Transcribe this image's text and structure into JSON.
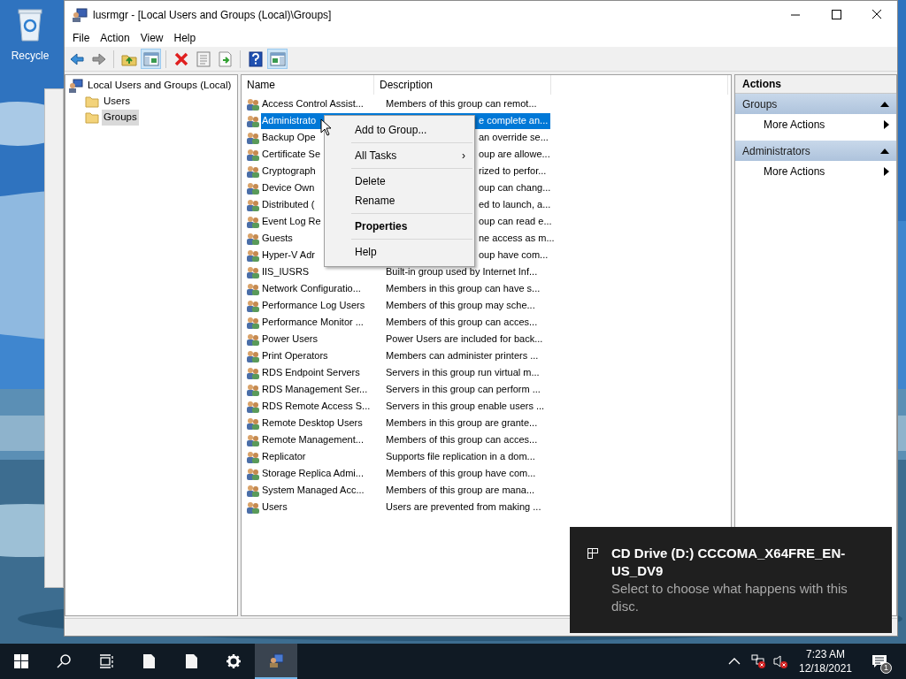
{
  "desktop": {
    "icons": [
      {
        "label": "Recycle"
      }
    ]
  },
  "window": {
    "title": "lusrmgr - [Local Users and Groups (Local)\\Groups]"
  },
  "menu": [
    "File",
    "Action",
    "View",
    "Help"
  ],
  "toolbar": [
    {
      "kind": "back",
      "pressed": false
    },
    {
      "kind": "forward",
      "pressed": false
    },
    {
      "kind": "sep"
    },
    {
      "kind": "up",
      "pressed": false
    },
    {
      "kind": "tree",
      "pressed": true
    },
    {
      "kind": "sep"
    },
    {
      "kind": "delete",
      "pressed": false
    },
    {
      "kind": "properties",
      "pressed": false
    },
    {
      "kind": "export",
      "pressed": false
    },
    {
      "kind": "sep"
    },
    {
      "kind": "help",
      "pressed": false
    },
    {
      "kind": "actionpane",
      "pressed": true
    }
  ],
  "tree": [
    {
      "label": "Local Users and Groups (Local)",
      "kind": "computer",
      "selected": false,
      "children": [
        {
          "label": "Users",
          "kind": "folder",
          "selected": false
        },
        {
          "label": "Groups",
          "kind": "folder",
          "selected": true
        }
      ]
    }
  ],
  "table": {
    "columns": [
      "Name",
      "Description"
    ],
    "rows": [
      {
        "name": "Access Control Assist...",
        "description": "Members of this group can remot...",
        "selected": false
      },
      {
        "name": "Administrato",
        "description": "e complete an...",
        "selected": true
      },
      {
        "name": "Backup Ope",
        "description": "an override se...",
        "selected": false
      },
      {
        "name": "Certificate Se",
        "description": "oup are allowe...",
        "selected": false
      },
      {
        "name": "Cryptograph",
        "description": "rized to perfor...",
        "selected": false
      },
      {
        "name": "Device Own",
        "description": "oup can chang...",
        "selected": false
      },
      {
        "name": "Distributed (",
        "description": "ed to launch, a...",
        "selected": false
      },
      {
        "name": "Event Log Re",
        "description": "oup can read e...",
        "selected": false
      },
      {
        "name": "Guests",
        "description": "ne access as m...",
        "selected": false
      },
      {
        "name": "Hyper-V Adr",
        "description": "oup have com...",
        "selected": false
      },
      {
        "name": "IIS_IUSRS",
        "description": "Built-in group used by Internet Inf...",
        "selected": false
      },
      {
        "name": "Network Configuratio...",
        "description": "Members in this group can have s...",
        "selected": false
      },
      {
        "name": "Performance Log Users",
        "description": "Members of this group may sche...",
        "selected": false
      },
      {
        "name": "Performance Monitor ...",
        "description": "Members of this group can acces...",
        "selected": false
      },
      {
        "name": "Power Users",
        "description": "Power Users are included for back...",
        "selected": false
      },
      {
        "name": "Print Operators",
        "description": "Members can administer printers ...",
        "selected": false
      },
      {
        "name": "RDS Endpoint Servers",
        "description": "Servers in this group run virtual m...",
        "selected": false
      },
      {
        "name": "RDS Management Ser...",
        "description": "Servers in this group can perform ...",
        "selected": false
      },
      {
        "name": "RDS Remote Access S...",
        "description": "Servers in this group enable users ...",
        "selected": false
      },
      {
        "name": "Remote Desktop Users",
        "description": "Members in this group are grante...",
        "selected": false
      },
      {
        "name": "Remote Management...",
        "description": "Members of this group can acces...",
        "selected": false
      },
      {
        "name": "Replicator",
        "description": "Supports file replication in a dom...",
        "selected": false
      },
      {
        "name": "Storage Replica Admi...",
        "description": "Members of this group have com...",
        "selected": false
      },
      {
        "name": "System Managed Acc...",
        "description": "Members of this group are mana...",
        "selected": false
      },
      {
        "name": "Users",
        "description": "Users are prevented from making ...",
        "selected": false
      }
    ]
  },
  "context_menu": [
    {
      "kind": "item",
      "label": "Add to Group..."
    },
    {
      "kind": "sep"
    },
    {
      "kind": "submenu",
      "label": "All Tasks",
      "arrow": "›"
    },
    {
      "kind": "sep"
    },
    {
      "kind": "item",
      "label": "Delete"
    },
    {
      "kind": "item",
      "label": "Rename"
    },
    {
      "kind": "sep"
    },
    {
      "kind": "default",
      "label": "Properties"
    },
    {
      "kind": "sep"
    },
    {
      "kind": "item",
      "label": "Help"
    }
  ],
  "actions": {
    "title": "Actions",
    "sections": [
      {
        "title": "Groups",
        "expanded": true,
        "items": [
          "More Actions"
        ]
      },
      {
        "title": "Administrators",
        "expanded": true,
        "items": [
          "More Actions"
        ]
      }
    ]
  },
  "notification": {
    "title": "CD Drive (D:) CCCOMA_X64FRE_EN-US_DV9",
    "body": "Select to choose what happens with this disc."
  },
  "taskbar": {
    "items": [
      {
        "kind": "start",
        "selected": false
      },
      {
        "kind": "search",
        "selected": false
      },
      {
        "kind": "taskview",
        "selected": false
      },
      {
        "kind": "document",
        "selected": false
      },
      {
        "kind": "document",
        "selected": false
      },
      {
        "kind": "settings",
        "selected": false
      },
      {
        "kind": "users",
        "selected": true
      }
    ],
    "time": "7:23 AM",
    "date": "12/18/2021",
    "notification_count": "1"
  }
}
